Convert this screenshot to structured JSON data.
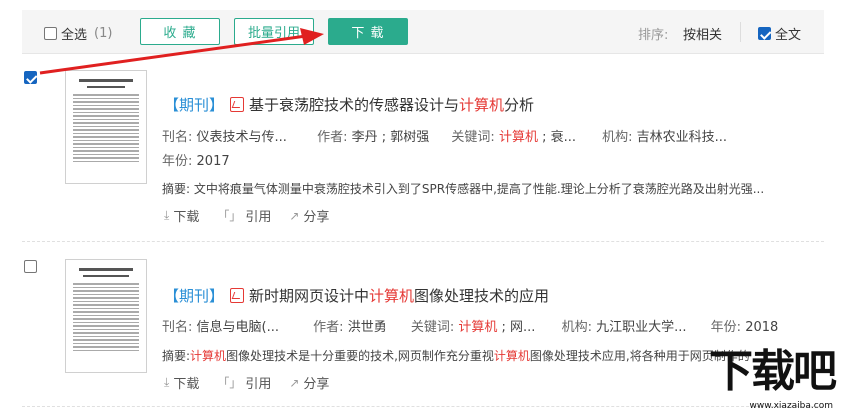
{
  "toolbar": {
    "select_all_label": "全选",
    "count": "(1)",
    "collect_label": "收 藏",
    "batch_cite_label": "批量引用",
    "download_label": "下 载",
    "sort_label": "排序:",
    "sort_value": "按相关",
    "fulltext_label": "全文",
    "accent_color": "#2bab8d"
  },
  "results": [
    {
      "checked": true,
      "tag": "【期刊】",
      "title_before": "基于衰荡腔技术的传感器设计与",
      "title_highlight": "计算机",
      "title_after": "分析",
      "journal_key": "刊名:",
      "journal": "仪表技术与传...",
      "author_key": "作者:",
      "author": "李丹 ; 郭树强",
      "keyword_key": "关键词:",
      "keyword_hl": "计算机",
      "keyword_rest": " ; 衰...",
      "org_key": "机构:",
      "org": "吉林农业科技...",
      "year_key": "年份:",
      "year": "2017",
      "abstract_key": "摘要:",
      "abstract_hl": "",
      "abstract_text": "文中将痕量气体测量中衰荡腔技术引入到了SPR传感器中,提高了性能.理论上分析了衰荡腔光路及出射光强...",
      "download_label": "下载",
      "cite_label": "引用",
      "share_label": "分享"
    },
    {
      "checked": false,
      "tag": "【期刊】",
      "title_before": "新时期网页设计中",
      "title_highlight": "计算机",
      "title_after": "图像处理技术的应用",
      "journal_key": "刊名:",
      "journal": "信息与电脑(...",
      "author_key": "作者:",
      "author": "洪世勇",
      "keyword_key": "关键词:",
      "keyword_hl": "计算机",
      "keyword_rest": " ; 网...",
      "org_key": "机构:",
      "org": "九江职业大学...",
      "year_key": "年份:",
      "year": "2018",
      "abstract_key": "摘要:",
      "abstract_hl": "计算机",
      "abstract_text": "图像处理技术是十分重要的技术,网页制作充分重视",
      "abstract_hl2": "计算机",
      "abstract_text2": "图像处理技术应用,将各种用于网页制作的",
      "download_label": "下载",
      "cite_label": "引用",
      "share_label": "分享"
    }
  ],
  "watermark": {
    "logo": "下载吧",
    "url": "www.xiazaiba.com"
  }
}
